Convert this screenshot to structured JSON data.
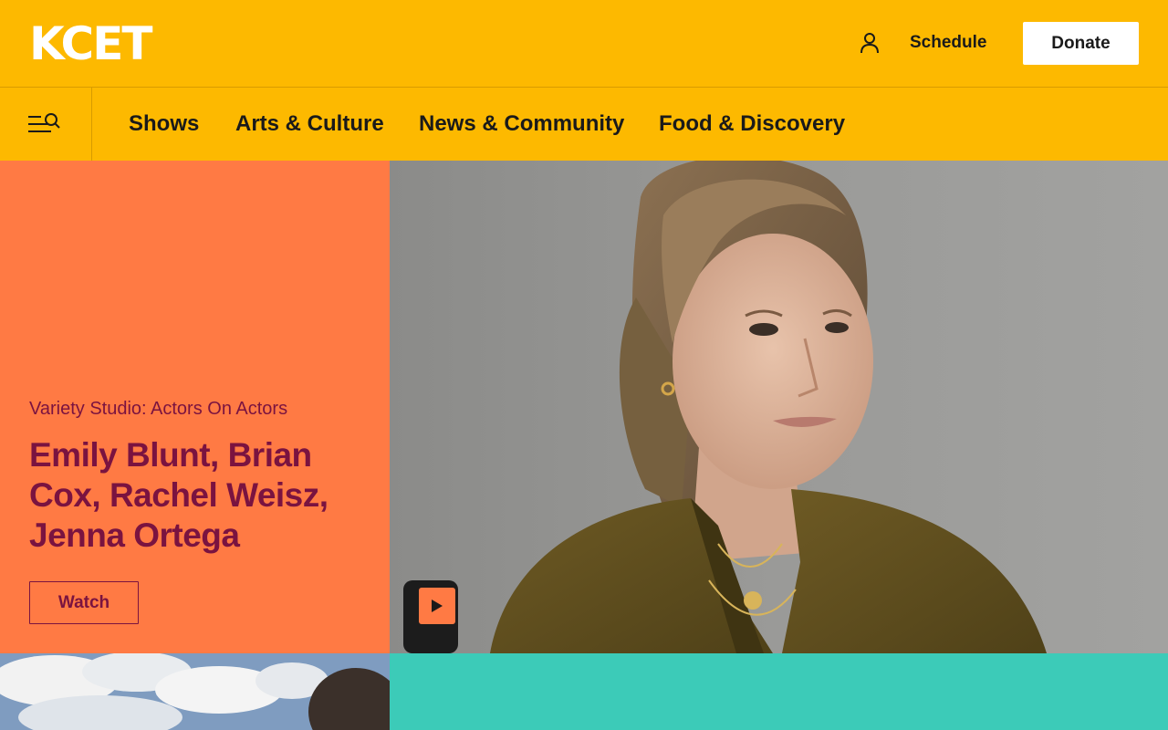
{
  "header": {
    "logo_text": "KCET",
    "user_icon": "user-icon",
    "schedule_label": "Schedule",
    "donate_label": "Donate",
    "background_color": "#FDB900"
  },
  "nav": {
    "menu_icon": "menu-search-icon",
    "items": [
      {
        "label": "Shows"
      },
      {
        "label": "Arts & Culture"
      },
      {
        "label": "News & Community"
      },
      {
        "label": "Food & Discovery"
      }
    ]
  },
  "hero": {
    "eyebrow": "Variety Studio: Actors On Actors",
    "title": "Emily Blunt, Brian Cox, Rachel Weisz, Jenna Ortega",
    "watch_label": "Watch",
    "play_icon": "play-icon",
    "panel_color": "#FF7A44",
    "text_color": "#7a1340"
  },
  "lower_row": {
    "right_tile_color": "#3CCBB8"
  }
}
